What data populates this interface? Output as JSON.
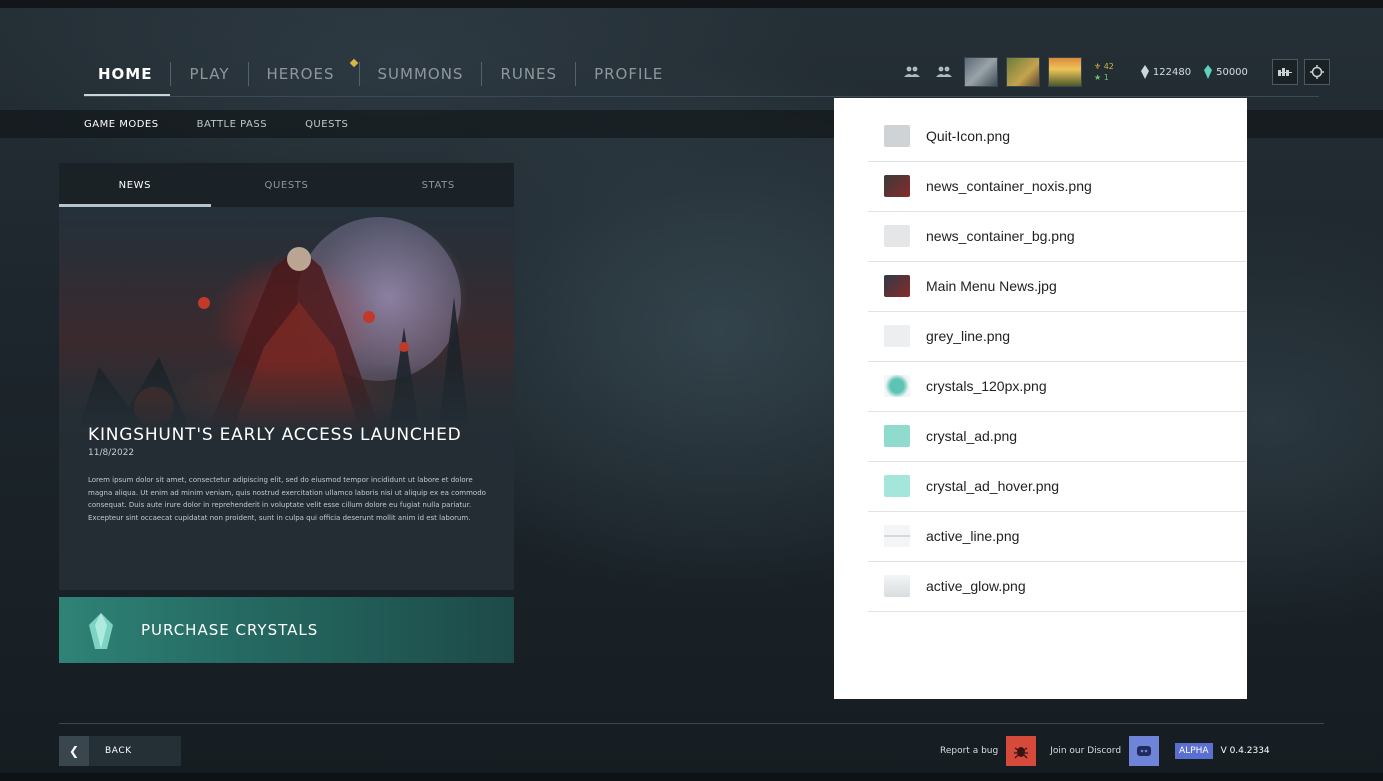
{
  "nav": {
    "tabs": [
      {
        "label": "HOME",
        "active": true
      },
      {
        "label": "PLAY"
      },
      {
        "label": "HEROES",
        "notification": true
      },
      {
        "label": "SUMMONS"
      },
      {
        "label": "RUNES"
      },
      {
        "label": "PROFILE"
      }
    ]
  },
  "subnav": {
    "items": [
      "GAME MODES",
      "BATTLE PASS",
      "QUESTS"
    ]
  },
  "hud": {
    "stat_gold": "42",
    "stat_green": "1",
    "currency_primary": "122480",
    "currency_crystals": "50000",
    "friends_icon": "friends-icon",
    "group_icon": "group-icon",
    "settings_icon": "gear-icon"
  },
  "panel": {
    "tabs": [
      "NEWS",
      "QUESTS",
      "STATS"
    ],
    "news": {
      "title": "KINGSHUNT'S EARLY ACCESS LAUNCHED",
      "date": "11/8/2022",
      "body": "Lorem ipsum dolor sit amet, consectetur adipiscing elit, sed do eiusmod tempor incididunt ut labore et dolore magna aliqua. Ut enim ad minim veniam, quis nostrud exercitation ullamco laboris nisi ut aliquip ex ea commodo consequat. Duis aute irure dolor in reprehenderit in voluptate velit esse cillum dolore eu fugiat nulla pariatur. Excepteur sint occaecat cupidatat non proident, sunt in culpa qui officia deserunt mollit anim id est laborum."
    }
  },
  "purchase": {
    "label": "PURCHASE CRYSTALS"
  },
  "footer": {
    "back": "BACK",
    "report_bug": "Report a bug",
    "discord": "Join our Discord",
    "alpha": "ALPHA",
    "version": "V 0.4.2334"
  },
  "files": [
    {
      "name": "Quit-Icon.png",
      "thumb": "#cfd3d6"
    },
    {
      "name": "news_container_noxis.png",
      "thumb": "#8a2a2a"
    },
    {
      "name": "news_container_bg.png",
      "thumb": "#e4e6e8"
    },
    {
      "name": "Main Menu News.jpg",
      "thumb": "#2d3b45"
    },
    {
      "name": "grey_line.png",
      "thumb": "#eceef0"
    },
    {
      "name": "crystals_120px.png",
      "thumb": "#5cc4b4"
    },
    {
      "name": "crystal_ad.png",
      "thumb": "#8fdccf"
    },
    {
      "name": "crystal_ad_hover.png",
      "thumb": "#a5e6da"
    },
    {
      "name": "active_line.png",
      "thumb": "#dfe3e5"
    },
    {
      "name": "active_glow.png",
      "thumb": "#d9dddf"
    }
  ],
  "colors": {
    "accent_teal": "#2f8376",
    "alpha_badge": "#5b6fd0",
    "bug_red": "#d64a3b",
    "discord_blue": "#6f83d8",
    "notification_gold": "#d9b545"
  }
}
